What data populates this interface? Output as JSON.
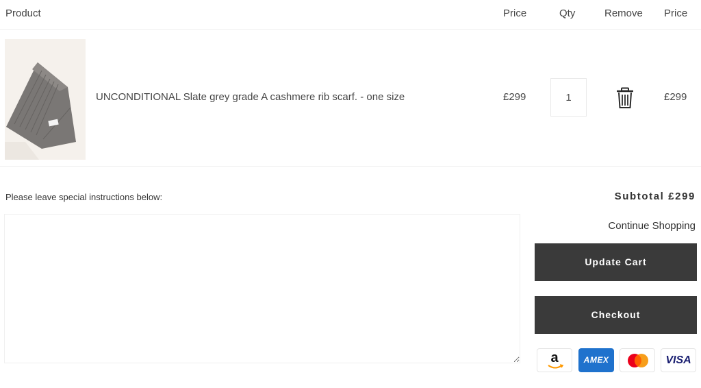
{
  "header": {
    "product": "Product",
    "price": "Price",
    "qty": "Qty",
    "remove": "Remove",
    "total": "Price"
  },
  "items": [
    {
      "name": "UNCONDITIONAL Slate grey grade A cashmere rib scarf. - one size",
      "price": "£299",
      "qty": "1",
      "total": "£299",
      "image_icon": "grey-scarf-product-image",
      "remove_icon": "trash-icon"
    }
  ],
  "instructions": {
    "label": "Please leave special instructions below:",
    "value": ""
  },
  "summary": {
    "subtotal": "Subtotal £299",
    "continue_shopping": "Continue Shopping",
    "update_cart": "Update Cart",
    "checkout": "Checkout"
  },
  "payment_methods": [
    {
      "name": "amazon-pay-icon",
      "label": "a"
    },
    {
      "name": "amex-icon",
      "label": "AMEX"
    },
    {
      "name": "mastercard-icon",
      "label": ""
    },
    {
      "name": "visa-icon",
      "label": "VISA"
    }
  ],
  "colors": {
    "button_bg": "#3a3a3a",
    "button_text": "#ffffff",
    "amex_blue": "#1f72cd",
    "visa_blue": "#1a1f71",
    "mc_red": "#eb001b",
    "mc_orange": "#f79e1b"
  }
}
